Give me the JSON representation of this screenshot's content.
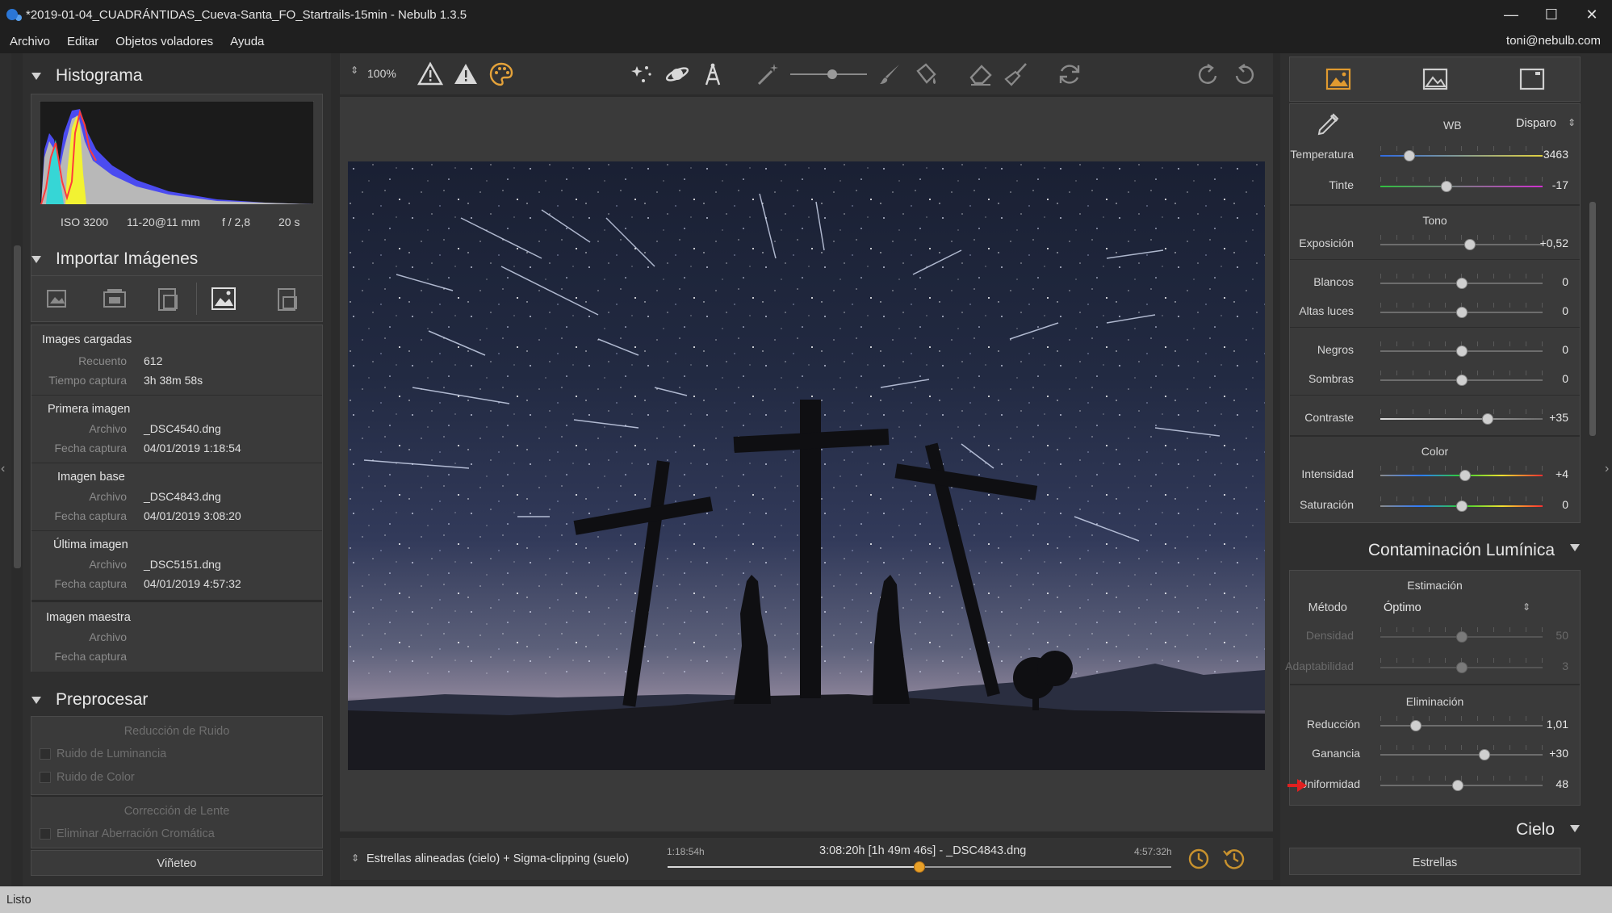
{
  "window": {
    "title": "*2019-01-04_CUADRÁNTIDAS_Cueva-Santa_FO_Startrails-15min - Nebulb 1.3.5",
    "minimize": "—",
    "maximize": "☐",
    "close": "✕"
  },
  "menu": {
    "items": [
      "Archivo",
      "Editar",
      "Objetos voladores",
      "Ayuda"
    ],
    "user": "toni@nebulb.com"
  },
  "histogram": {
    "title": "Histograma",
    "iso": "ISO 3200",
    "lens": "11-20@11 mm",
    "aperture": "f / 2,8",
    "exposure": "20 s"
  },
  "import": {
    "title": "Importar Imágenes",
    "loaded": {
      "title": "Images cargadas",
      "count_label": "Recuento",
      "count": "612",
      "time_label": "Tiempo captura",
      "time": "3h 38m 58s"
    },
    "first": {
      "title": "Primera imagen",
      "file_label": "Archivo",
      "file": "_DSC4540.dng",
      "date_label": "Fecha captura",
      "date": "04/01/2019 1:18:54"
    },
    "base": {
      "title": "Imagen base",
      "file_label": "Archivo",
      "file": "_DSC4843.dng",
      "date_label": "Fecha captura",
      "date": "04/01/2019 3:08:20"
    },
    "last": {
      "title": "Última imagen",
      "file_label": "Archivo",
      "file": "_DSC5151.dng",
      "date_label": "Fecha captura",
      "date": "04/01/2019 4:57:32"
    },
    "master": {
      "title": "Imagen maestra",
      "file_label": "Archivo",
      "date_label": "Fecha captura"
    }
  },
  "preprocess": {
    "title": "Preprocesar",
    "noise_title": "Reducción de Ruido",
    "luminance": "Ruido de Luminancia",
    "color": "Ruido de Color",
    "lens_title": "Corrección de Lente",
    "chromatic": "Eliminar Aberración Cromática",
    "vignette": "Viñeteo"
  },
  "toolbar": {
    "zoom": "100%"
  },
  "bottom": {
    "mode": "Estrellas alineadas (cielo) + Sigma-clipping (suelo)",
    "start": "1:18:54h",
    "center": "3:08:20h [1h 49m 46s] - _DSC4843.dng",
    "end": "4:57:32h",
    "timeline_position": 0.5
  },
  "right": {
    "wb_label": "WB",
    "wb_value": "Disparo",
    "temperature": {
      "label": "Temperatura",
      "value": "3463",
      "pos": 0.18
    },
    "tint": {
      "label": "Tinte",
      "value": "-17",
      "pos": 0.41
    },
    "tone_title": "Tono",
    "exposure": {
      "label": "Exposición",
      "value": "+0,52",
      "pos": 0.55
    },
    "whites": {
      "label": "Blancos",
      "value": "0",
      "pos": 0.5
    },
    "highlights": {
      "label": "Altas luces",
      "value": "0",
      "pos": 0.5
    },
    "blacks": {
      "label": "Negros",
      "value": "0",
      "pos": 0.5
    },
    "shadows": {
      "label": "Sombras",
      "value": "0",
      "pos": 0.5
    },
    "contrast": {
      "label": "Contraste",
      "value": "+35",
      "pos": 0.66
    },
    "color_title": "Color",
    "intensity": {
      "label": "Intensidad",
      "value": "+4",
      "pos": 0.52
    },
    "saturation": {
      "label": "Saturación",
      "value": "0",
      "pos": 0.5
    },
    "lp_title": "Contaminación Lumínica",
    "estimation_title": "Estimación",
    "method_label": "Método",
    "method_value": "Óptimo",
    "density": {
      "label": "Densidad",
      "value": "50",
      "pos": 0.5
    },
    "adaptability": {
      "label": "Adaptabilidad",
      "value": "3",
      "pos": 0.5
    },
    "elimination_title": "Eliminación",
    "reduction": {
      "label": "Reducción",
      "value": "1,01",
      "pos": 0.22
    },
    "gain": {
      "label": "Ganancia",
      "value": "+30",
      "pos": 0.64
    },
    "uniformity": {
      "label": "Uniformidad",
      "value": "48",
      "pos": 0.48
    },
    "sky_title": "Cielo",
    "stars_label": "Estrellas"
  },
  "status": {
    "text": "Listo"
  }
}
